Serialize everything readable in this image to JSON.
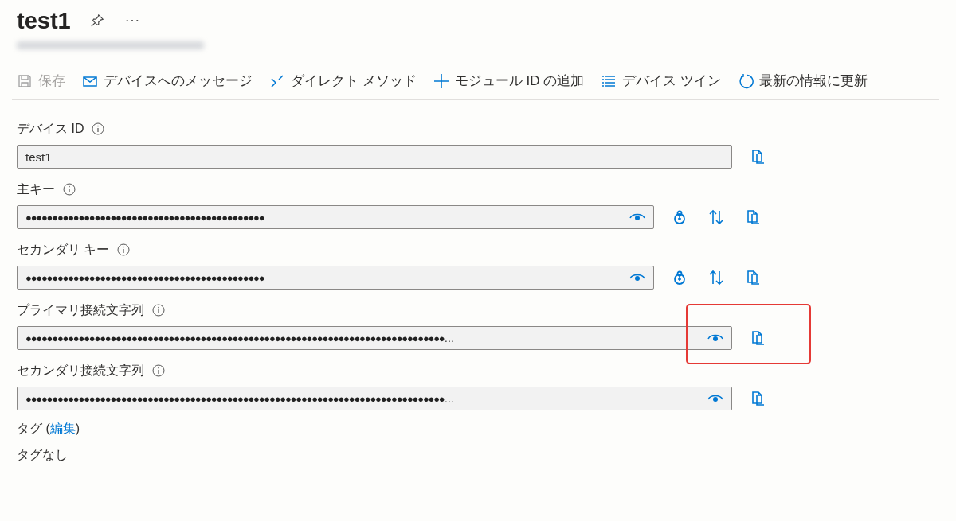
{
  "header": {
    "title": "test1",
    "subtitle_blurred": true
  },
  "toolbar": [
    {
      "kind": "save",
      "label": "保存",
      "disabled": true
    },
    {
      "kind": "message",
      "label": "デバイスへのメッセージ",
      "disabled": false
    },
    {
      "kind": "method",
      "label": "ダイレクト メソッド",
      "disabled": false
    },
    {
      "kind": "add",
      "label": "モジュール ID の追加",
      "disabled": false
    },
    {
      "kind": "twin",
      "label": "デバイス ツイン",
      "disabled": false
    },
    {
      "kind": "refresh",
      "label": "最新の情報に更新",
      "disabled": false
    }
  ],
  "fields": [
    {
      "label": "デバイス ID",
      "kind": "text",
      "value": "test1",
      "wide": true,
      "highlighted": false,
      "actions": [
        {
          "kind": "copy"
        }
      ]
    },
    {
      "label": "主キー",
      "kind": "secret",
      "value": "●●●●●●●●●●●●●●●●●●●●●●●●●●●●●●●●●●●●●●●●●●●●●",
      "wide": false,
      "highlighted": false,
      "actions": [
        {
          "kind": "regenerate"
        },
        {
          "kind": "swap"
        },
        {
          "kind": "copy"
        }
      ]
    },
    {
      "label": "セカンダリ キー",
      "kind": "secret",
      "value": "●●●●●●●●●●●●●●●●●●●●●●●●●●●●●●●●●●●●●●●●●●●●●",
      "wide": false,
      "highlighted": false,
      "actions": [
        {
          "kind": "regenerate"
        },
        {
          "kind": "swap"
        },
        {
          "kind": "copy"
        }
      ]
    },
    {
      "label": "プライマリ接続文字列",
      "kind": "secret",
      "value": "●●●●●●●●●●●●●●●●●●●●●●●●●●●●●●●●●●●●●●●●●●●●●●●●●●●●●●●●●●●●●●●●●●●●●●●●●●●●●●●…",
      "wide": true,
      "highlighted": true,
      "actions": [
        {
          "kind": "copy"
        }
      ]
    },
    {
      "label": "セカンダリ接続文字列",
      "kind": "secret",
      "value": "●●●●●●●●●●●●●●●●●●●●●●●●●●●●●●●●●●●●●●●●●●●●●●●●●●●●●●●●●●●●●●●●●●●●●●●●●●●●●●●…",
      "wide": true,
      "highlighted": false,
      "actions": [
        {
          "kind": "copy"
        }
      ]
    }
  ],
  "tags": {
    "label": "タグ (",
    "link": "編集",
    "label_end": ")",
    "value": "タグなし"
  }
}
